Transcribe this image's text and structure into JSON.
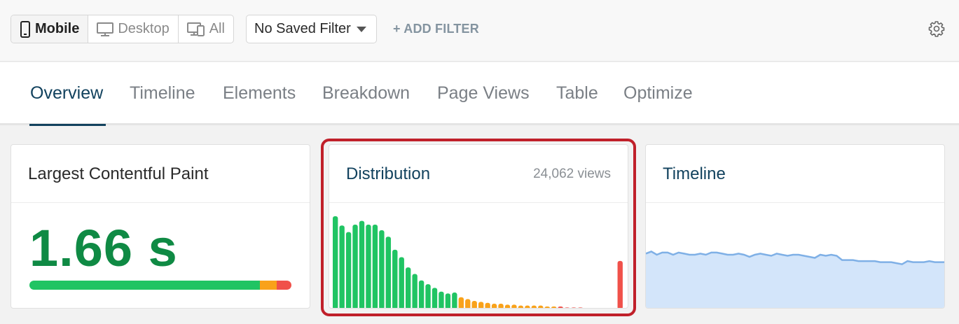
{
  "toolbar": {
    "devices": [
      {
        "label": "Mobile",
        "icon": "mobile-icon",
        "active": true
      },
      {
        "label": "Desktop",
        "icon": "desktop-icon",
        "active": false
      },
      {
        "label": "All",
        "icon": "all-devices-icon",
        "active": false
      }
    ],
    "filter_select": "No Saved Filter",
    "add_filter": "+ ADD FILTER",
    "settings_icon": "gear-icon"
  },
  "tabs": [
    {
      "label": "Overview",
      "active": true
    },
    {
      "label": "Timeline",
      "active": false
    },
    {
      "label": "Elements",
      "active": false
    },
    {
      "label": "Breakdown",
      "active": false
    },
    {
      "label": "Page Views",
      "active": false
    },
    {
      "label": "Table",
      "active": false
    },
    {
      "label": "Optimize",
      "active": false
    }
  ],
  "cards": {
    "metric": {
      "title": "Largest Contentful Paint",
      "value": "1.66 s",
      "rating_split": {
        "good": 0.88,
        "needs_improvement": 0.065,
        "poor": 0.055
      }
    },
    "distribution": {
      "title": "Distribution",
      "views": "24,062 views"
    },
    "timeline": {
      "title": "Timeline"
    }
  },
  "colors": {
    "good": "#20c463",
    "needs_improvement": "#f9a21a",
    "poor": "#f0514a",
    "accent": "#12425e",
    "metric_value": "#0f8a44",
    "timeline_line": "#7fb0e6",
    "timeline_fill": "#d3e5fa",
    "highlight": "#c0202a"
  },
  "chart_data": [
    {
      "type": "bar",
      "title": "Distribution",
      "ratings": [
        "good",
        "good",
        "good",
        "good",
        "good",
        "good",
        "good",
        "good",
        "good",
        "good",
        "good",
        "good",
        "good",
        "good",
        "good",
        "good",
        "good",
        "good",
        "good",
        "ni",
        "ni",
        "ni",
        "ni",
        "ni",
        "ni",
        "ni",
        "ni",
        "ni",
        "ni",
        "ni",
        "ni",
        "ni",
        "ni",
        "ni",
        "poor",
        "poor",
        "poor",
        "poor",
        "poor",
        "poor",
        "poor",
        "poor",
        "poor",
        "poor"
      ],
      "values": [
        100,
        90,
        83,
        91,
        95,
        91,
        91,
        85,
        78,
        64,
        56,
        45,
        38,
        31,
        27,
        23,
        19,
        17,
        18,
        13,
        11,
        9,
        8,
        7,
        6,
        6,
        5,
        5,
        4,
        4,
        4,
        4,
        3,
        3,
        3,
        2,
        2,
        2,
        1,
        1,
        1,
        1,
        1,
        52
      ]
    },
    {
      "type": "area",
      "title": "Timeline",
      "values": [
        53,
        55,
        52,
        54,
        54,
        52,
        54,
        53,
        52,
        52,
        53,
        52,
        54,
        54,
        53,
        52,
        52,
        53,
        52,
        50,
        52,
        53,
        52,
        51,
        53,
        52,
        51,
        52,
        52,
        51,
        50,
        49,
        52,
        51,
        52,
        51,
        47,
        47,
        47,
        46,
        46,
        46,
        46,
        45,
        45,
        45,
        44,
        43,
        46,
        45,
        45,
        45,
        46,
        45,
        45,
        45
      ]
    }
  ]
}
